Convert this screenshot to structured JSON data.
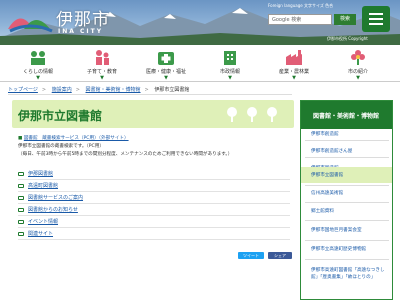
{
  "header": {
    "logo_text": "伊那市",
    "logo_sub": "INA CITY",
    "util_links": "Foreign language  文字サイズ  色合",
    "search_placeholder": "Google 検索",
    "search_button": "検索",
    "accessibility": "伊那市役所 Copyright"
  },
  "nav": {
    "items": [
      {
        "label": "くらしの情報",
        "icon": "house-icon"
      },
      {
        "label": "子育て・教育",
        "icon": "family-icon"
      },
      {
        "label": "医療・健康・福祉",
        "icon": "medical-icon"
      },
      {
        "label": "市政情報",
        "icon": "building-icon"
      },
      {
        "label": "産業・農林業",
        "icon": "factory-icon"
      },
      {
        "label": "市の紹介",
        "icon": "flower-icon"
      }
    ]
  },
  "breadcrumb": [
    "トップページ",
    "施設案内",
    "図書館・美術館・博物館",
    "伊那市立図書館"
  ],
  "page": {
    "title": "伊那市立図書館",
    "link_line": "図書館　蔵書検索サービス（PC用）（外部サイト）",
    "desc1": "伊那市立図書館の蔵書検索です。（PC用）",
    "desc2": "（毎日、午前3時から午前5時までの間別分程度、メンテナンスのためご利用できない時間があります。）",
    "list": [
      "伊那図書館",
      "高遠町図書館",
      "図書館サービスのご案内",
      "図書館からのお知らせ",
      "イベント情報",
      "関連サイト"
    ],
    "share_tweet": "ツイート",
    "share_fb": "シェア"
  },
  "sidebar": {
    "heading": "図書館・美術館・博物館",
    "items": [
      "伊那市創造館",
      "伊那市創造館さん屋",
      "伊那市新造館",
      "伊那市立図書館",
      "信州高遠美術館",
      "郷土館資料",
      "伊那市国地巨月書案会室",
      "伊那市立高遠町歴史博物館",
      "伊那市高遠町図書館「高遠なつきし館」「歴奥書集」「故ほとりの」"
    ]
  },
  "colors": {
    "accent": "#1f7a2e",
    "light_green": "#dff0b8",
    "link": "#1a5aa8"
  }
}
